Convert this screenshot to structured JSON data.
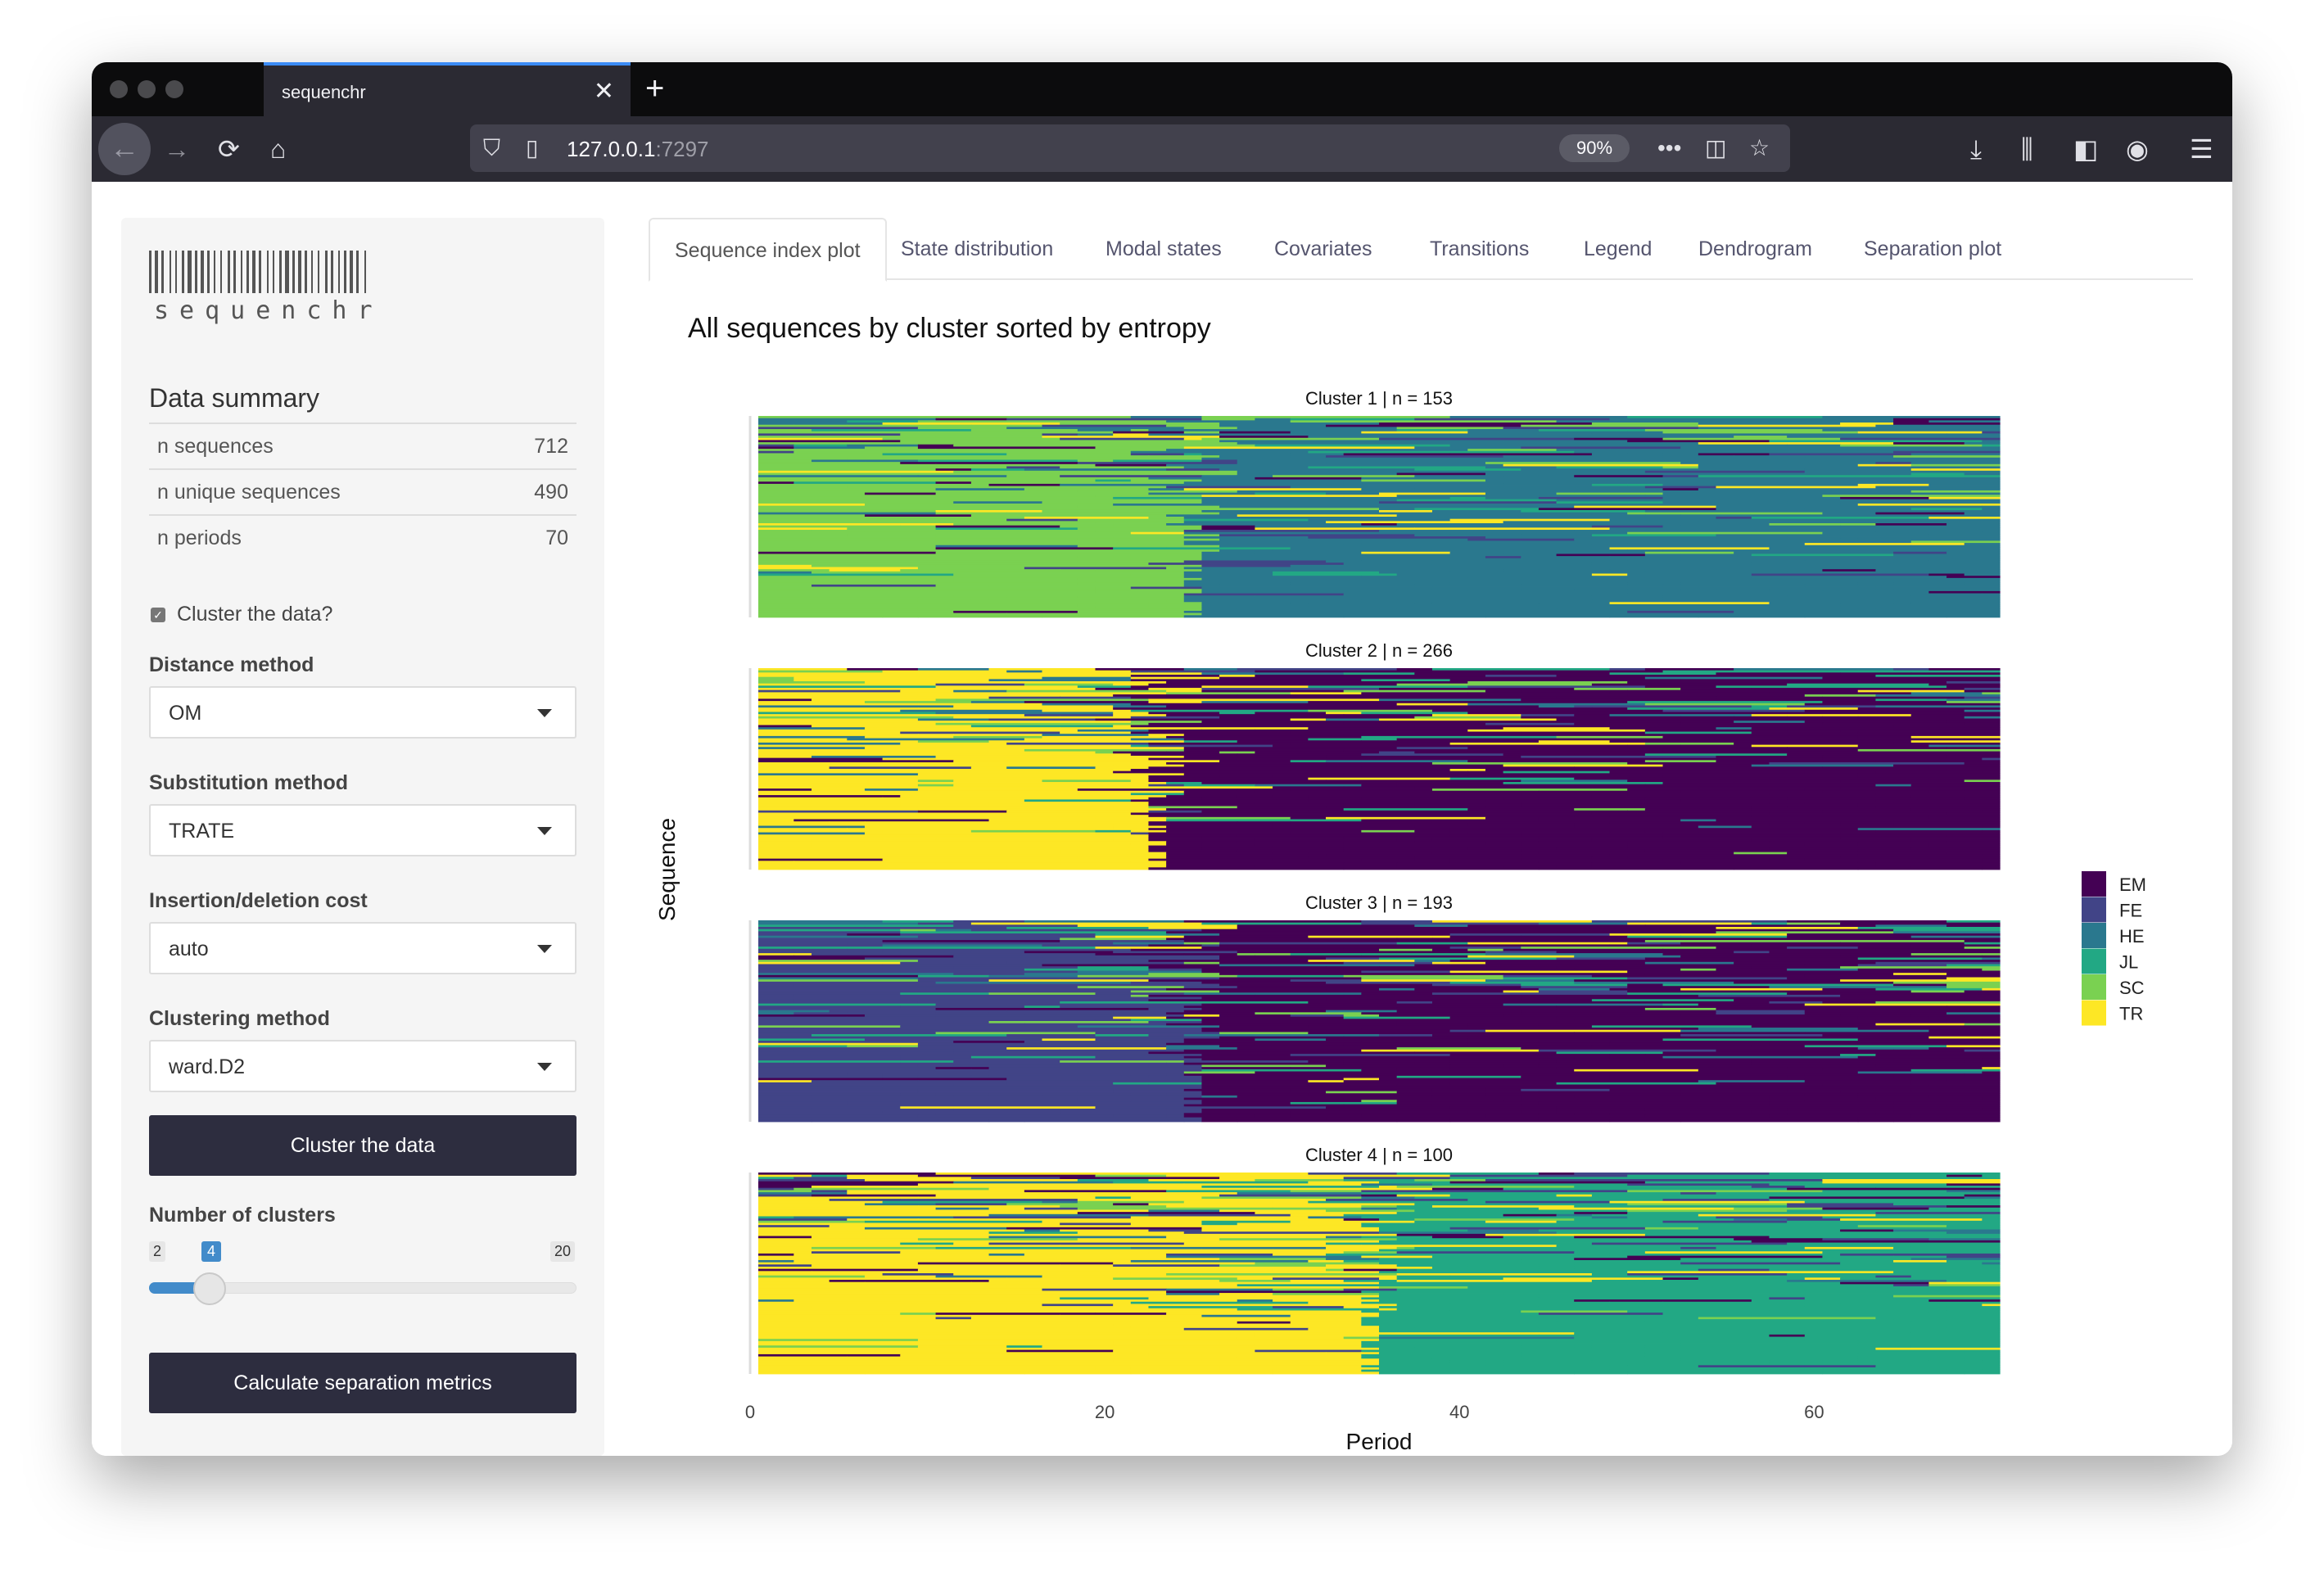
{
  "browser": {
    "tab_title": "sequenchr",
    "tab_close": "✕",
    "new_tab": "+",
    "url_host": "127.0.0.1",
    "url_port": ":7297",
    "zoom": "90%"
  },
  "sidebar": {
    "logo_text": "sequenchr",
    "summary_title": "Data summary",
    "summary_rows": [
      {
        "label": "n sequences",
        "value": "712"
      },
      {
        "label": "n unique sequences",
        "value": "490"
      },
      {
        "label": "n periods",
        "value": "70"
      }
    ],
    "cluster_checkbox": "Cluster the data?",
    "distance_label": "Distance method",
    "distance_value": "OM",
    "substitution_label": "Substitution method",
    "substitution_value": "TRATE",
    "indel_label": "Insertion/deletion cost",
    "indel_value": "auto",
    "clustering_label": "Clustering method",
    "clustering_value": "ward.D2",
    "cluster_button": "Cluster the data",
    "nclusters_label": "Number of clusters",
    "slider": {
      "min": "2",
      "max": "20",
      "value": "4",
      "fraction": 0.111
    },
    "separation_button": "Calculate separation metrics"
  },
  "tabs": [
    "Sequence index plot",
    "State distribution",
    "Modal states",
    "Covariates",
    "Transitions",
    "Legend",
    "Dendrogram",
    "Separation plot"
  ],
  "chart_data": {
    "type": "heatmap",
    "title": "All sequences by cluster sorted by entropy",
    "xlabel": "Period",
    "ylabel": "Sequence",
    "xlim": [
      0,
      70
    ],
    "xticks": [
      "0",
      "20",
      "40",
      "60"
    ],
    "states": [
      {
        "name": "EM",
        "color": "#440154"
      },
      {
        "name": "FE",
        "color": "#414487"
      },
      {
        "name": "HE",
        "color": "#2a788e"
      },
      {
        "name": "JL",
        "color": "#22a884"
      },
      {
        "name": "SC",
        "color": "#7ad151"
      },
      {
        "name": "TR",
        "color": "#fde725"
      }
    ],
    "panels": [
      {
        "label": "Cluster 1  | n =  153",
        "n": 153,
        "dominant": [
          "SC",
          "HE"
        ],
        "switch": 24
      },
      {
        "label": "Cluster 2  | n =  266",
        "n": 266,
        "dominant": [
          "TR",
          "EM"
        ],
        "switch": 22
      },
      {
        "label": "Cluster 3  | n =  193",
        "n": 193,
        "dominant": [
          "FE",
          "EM"
        ],
        "switch": 24
      },
      {
        "label": "Cluster 4  | n =  100",
        "n": 100,
        "dominant": [
          "TR",
          "JL"
        ],
        "switch": 34
      }
    ]
  }
}
